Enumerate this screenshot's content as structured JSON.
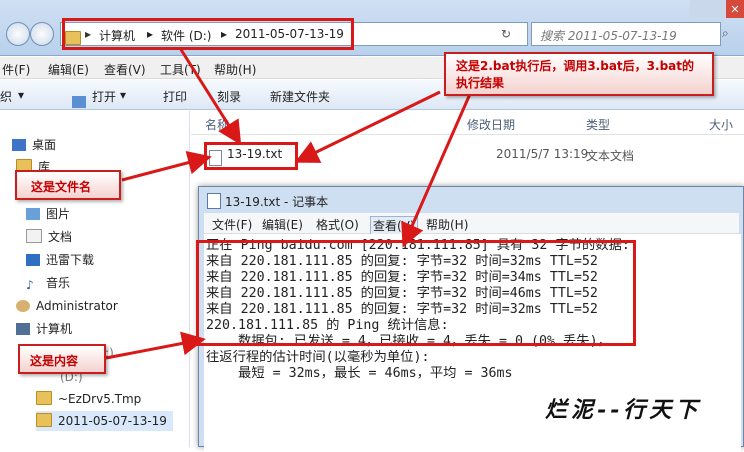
{
  "explorer": {
    "breadcrumb": [
      "计算机",
      "软件 (D:)",
      "2011-05-07-13-19"
    ],
    "search_placeholder": "搜索 2011-05-07-13-19",
    "menu": [
      "件(F)",
      "编辑(E)",
      "查看(V)",
      "工具(T)",
      "帮助(H)"
    ],
    "toolbar": [
      "织",
      "打开",
      "打印",
      "刻录",
      "新建文件夹"
    ],
    "columns": [
      "名称",
      "修改日期",
      "类型",
      "大小"
    ],
    "nav_items": [
      "桌面",
      "库",
      "图片",
      "文档",
      "迅雷下载",
      "音乐",
      "Administrator",
      "计算机",
      "(C:)",
      "(D:)",
      "~EzDrv5.Tmp",
      "2011-05-07-13-19"
    ],
    "file": {
      "name": "13-19.txt",
      "modified": "2011/5/7 13:19",
      "type": "文本文档"
    }
  },
  "notepad": {
    "title": "13-19.txt - 记事本",
    "menu": [
      "文件(F)",
      "编辑(E)",
      "格式(O)",
      "查看(V)",
      "帮助(H)"
    ],
    "lines": [
      "",
      "正在 Ping baidu.com [220.181.111.85] 具有 32 字节的数据:",
      "来自 220.181.111.85 的回复: 字节=32 时间=32ms TTL=52",
      "来自 220.181.111.85 的回复: 字节=32 时间=34ms TTL=52",
      "来自 220.181.111.85 的回复: 字节=32 时间=46ms TTL=52",
      "来自 220.181.111.85 的回复: 字节=32 时间=32ms TTL=52",
      "",
      "220.181.111.85 的 Ping 统计信息:",
      "    数据包: 已发送 = 4，已接收 = 4，丢失 = 0 (0% 丢失)，",
      "往返行程的估计时间(以毫秒为单位):",
      "    最短 = 32ms，最长 = 46ms，平均 = 36ms"
    ]
  },
  "annotations": {
    "top": "这是2.bat执行后，调用3.bat后，3.bat的执行结果",
    "filename": "这是文件名",
    "content": "这是内容"
  },
  "signature": "烂泥--行天下",
  "colors": {
    "annotation_red": "#d91818"
  }
}
